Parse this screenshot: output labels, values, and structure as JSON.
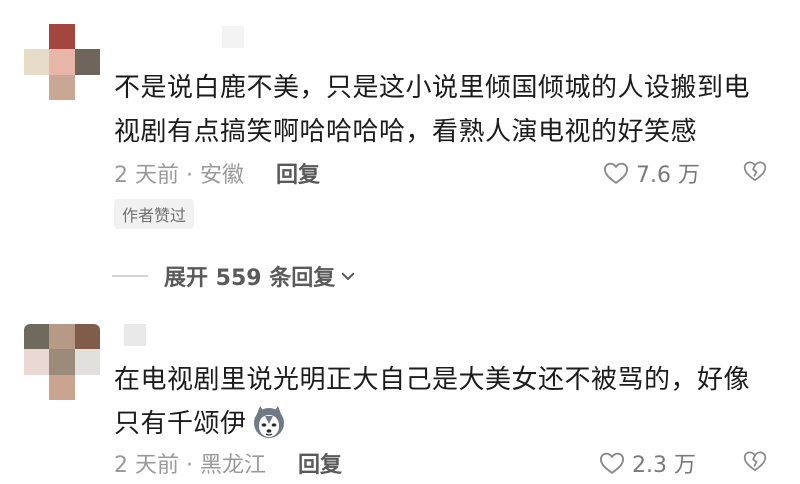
{
  "comments": [
    {
      "text": "不是说白鹿不美，只是这小说里倾国倾城的人设搬到电视剧有点搞笑啊哈哈哈哈，看熟人演电视的好笑感",
      "time_location": "2 天前 · 安徽",
      "reply_label": "回复",
      "likes": "7.6 万",
      "author_badge": "作者赞过",
      "expand_label": "展开 559 条回复",
      "avatar_colors": [
        "#ffffff",
        "#a3463d",
        "#ffffff",
        "#e6dcc8",
        "#e8b6a8",
        "#6f655a",
        "#ffffff",
        "#c8a894",
        "#ffffff"
      ],
      "name_mosaic_colors": [
        "#f3f3f3"
      ]
    },
    {
      "text": "在电视剧里说光明正大自己是大美女还不被骂的，好像只有千颂伊",
      "time_location": "2 天前 · 黑龙江",
      "reply_label": "回复",
      "likes": "2.3 万",
      "emoji_icon": "husky-dog-emoji",
      "avatar_colors": [
        "#6e6b5d",
        "#b69a86",
        "#7f5d4a",
        "#e9d8d3",
        "#9c8a7b",
        "#e2e0dc",
        "#ffffff",
        "#c9a48e",
        "#ffffff"
      ],
      "name_mosaic_colors": [
        "#e9e9e9"
      ]
    }
  ],
  "icons": {
    "like": "heart-outline-icon",
    "dislike": "broken-heart-icon",
    "expand": "chevron-down-icon"
  },
  "colors": {
    "meta_text": "#9a9a9a",
    "reply_text": "#5a5a5a",
    "badge_bg": "#f1f1f1"
  }
}
